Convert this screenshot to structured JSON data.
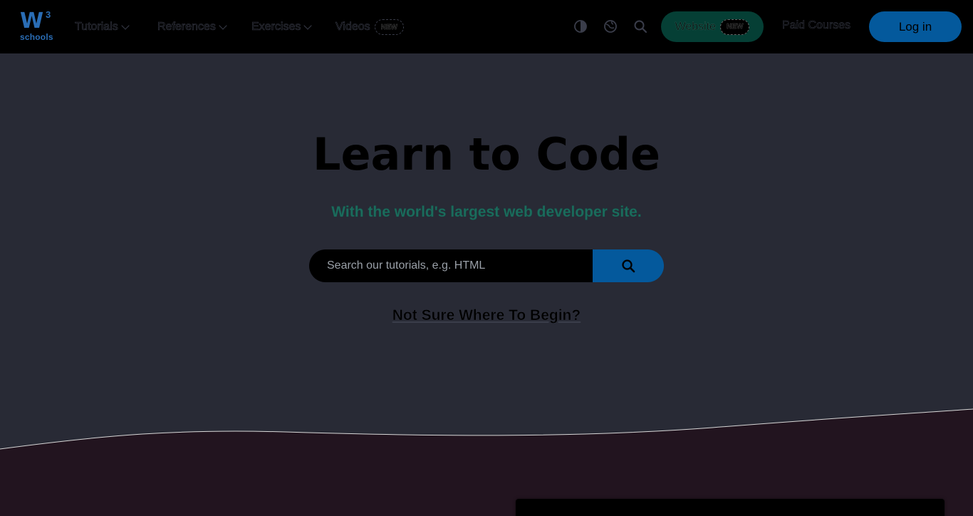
{
  "brand": {
    "logo_main": "W",
    "logo_sup": "3",
    "logo_sub": "schools"
  },
  "nav": {
    "tutorials": "Tutorials",
    "references": "References",
    "exercises": "Exercises",
    "videos": "Videos",
    "videos_badge": "NEW",
    "website": "Website",
    "website_badge": "NEW",
    "paid_courses": "Paid Courses",
    "login": "Log in"
  },
  "icons": [
    "contrast-icon",
    "globe-icon",
    "search-icon",
    "chevron-down-icon"
  ],
  "hero": {
    "title": "Learn to Code",
    "subtitle": "With the world's largest web developer site.",
    "search_placeholder": "Search our tutorials, e.g. HTML",
    "begin_link": "Not Sure Where To Begin?"
  },
  "colors": {
    "nav_bg": "#000000",
    "hero_bg": "#282a35",
    "accent_green": "#04aa6d",
    "accent_blue": "#04599c",
    "bottom_bg": "#22141f"
  }
}
